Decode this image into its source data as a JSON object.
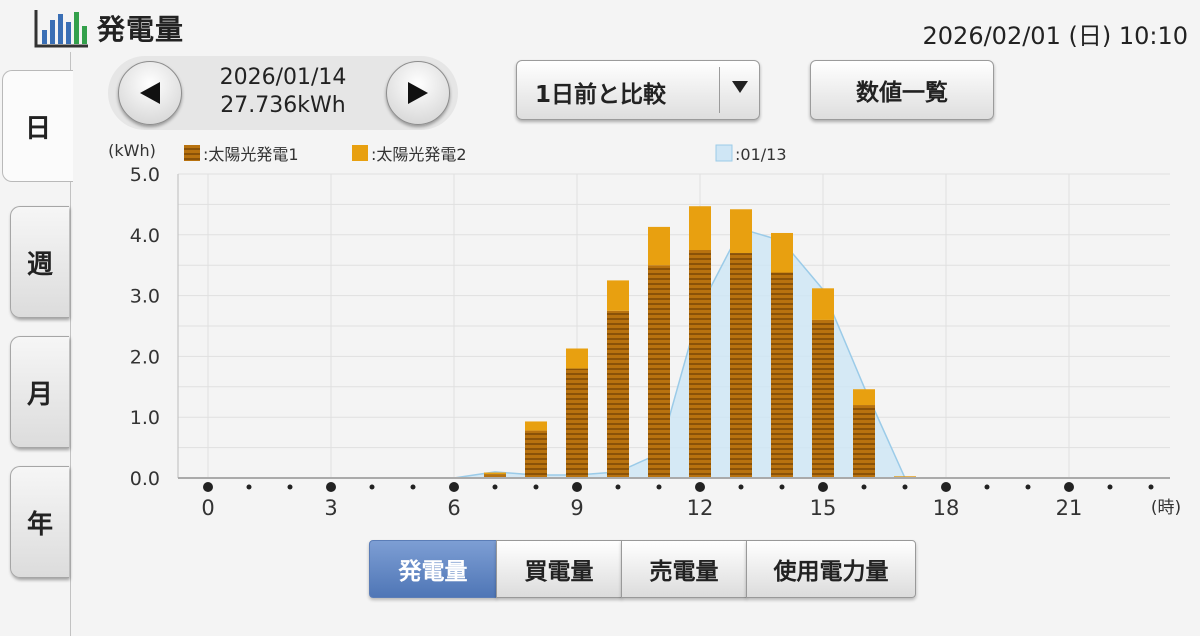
{
  "header": {
    "title": "発電量",
    "datetime": "2026/02/01 (日) 10:10",
    "icon": "bar-chart-icon"
  },
  "tabs": [
    {
      "label": "日",
      "active": true
    },
    {
      "label": "週",
      "active": false
    },
    {
      "label": "月",
      "active": false
    },
    {
      "label": "年",
      "active": false
    }
  ],
  "date_nav": {
    "date": "2026/01/14",
    "total": "27.736kWh",
    "prev_icon": "triangle-left-icon",
    "next_icon": "triangle-right-icon"
  },
  "compare": {
    "label": "1日前と比較",
    "arrow_icon": "triangle-down-icon"
  },
  "list_button": "数値一覧",
  "mode_buttons": [
    {
      "label": "発電量",
      "active": true
    },
    {
      "label": "買電量",
      "active": false
    },
    {
      "label": "売電量",
      "active": false
    },
    {
      "label": "使用電力量",
      "active": false
    }
  ],
  "colors": {
    "series1": "#b8720f",
    "series2": "#e8a010",
    "compare_fill": "#cfe6f5",
    "compare_line": "#9bcbe8",
    "active_mode": "#5a80bf"
  },
  "chart_data": {
    "type": "bar",
    "ylabel": "(kWh)",
    "xunit": "(時)",
    "ylim": [
      0,
      5
    ],
    "yticks": [
      "0.0",
      "1.0",
      "2.0",
      "3.0",
      "4.0",
      "5.0"
    ],
    "xticks": [
      "0",
      "3",
      "6",
      "9",
      "12",
      "15",
      "18",
      "21"
    ],
    "hours": [
      0,
      1,
      2,
      3,
      4,
      5,
      6,
      7,
      8,
      9,
      10,
      11,
      12,
      13,
      14,
      15,
      16,
      17,
      18,
      19,
      20,
      21,
      22,
      23
    ],
    "series": [
      {
        "name": "太陽光発電1",
        "values": [
          0,
          0,
          0,
          0,
          0,
          0,
          0,
          0.06,
          0.78,
          1.8,
          2.75,
          3.5,
          3.75,
          3.7,
          3.38,
          2.6,
          1.2,
          0.02,
          0,
          0,
          0,
          0,
          0,
          0
        ]
      },
      {
        "name": "太陽光発電2",
        "values": [
          0,
          0,
          0,
          0,
          0,
          0,
          0,
          0.03,
          0.15,
          0.33,
          0.5,
          0.63,
          0.72,
          0.72,
          0.65,
          0.52,
          0.26,
          0.01,
          0,
          0,
          0,
          0,
          0,
          0
        ]
      }
    ],
    "compare": {
      "name": "01/13",
      "values": [
        0,
        0,
        0,
        0,
        0,
        0,
        0,
        0.1,
        0.05,
        0.05,
        0.1,
        0.4,
        2.8,
        4.1,
        3.9,
        3.1,
        1.5,
        0,
        0,
        0,
        0,
        0,
        0,
        0
      ]
    },
    "legend_position": "top"
  }
}
